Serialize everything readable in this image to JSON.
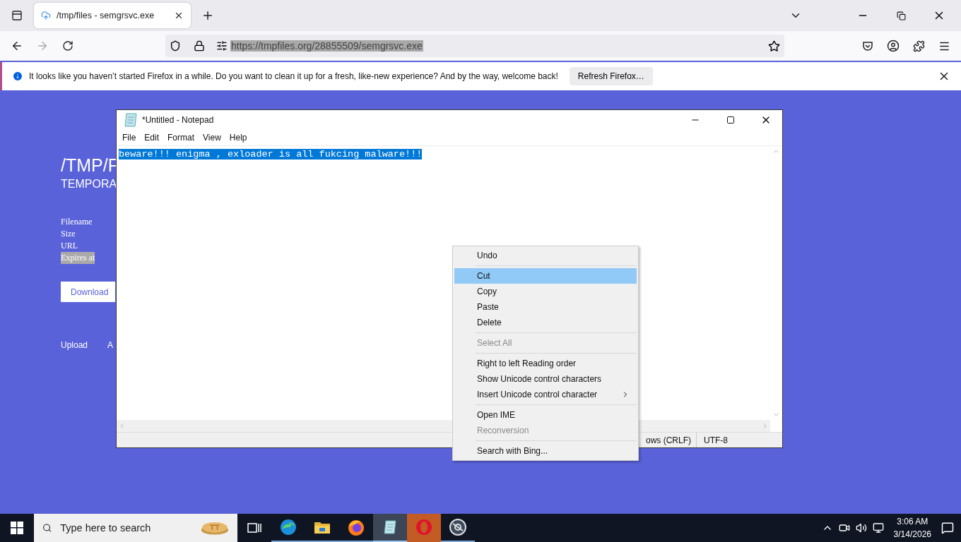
{
  "browser": {
    "tabs": [
      {
        "title": "/tmp/files - semgrsvc.exe",
        "selected": true
      }
    ],
    "url": "https://tmpfiles.org/28855509/semgrsvc.exe",
    "url_selected": true
  },
  "notification": {
    "message": "It looks like you haven’t started Firefox in a while. Do you want to clean it up for a fresh, like-new experience? And by the way, welcome back!",
    "button": "Refresh Firefox…"
  },
  "site": {
    "title": "/TMP/F",
    "subtitle": "TEMPORA",
    "fields": [
      {
        "label": "Filename",
        "highlighted": false
      },
      {
        "label": "Size",
        "highlighted": false
      },
      {
        "label": "URL",
        "highlighted": false
      },
      {
        "label": "Expires at",
        "highlighted": true
      }
    ],
    "download": "Download",
    "links": [
      "Upload",
      "A"
    ]
  },
  "notepad": {
    "title": "*Untitled - Notepad",
    "menu": [
      "File",
      "Edit",
      "Format",
      "View",
      "Help"
    ],
    "text": "beware!!! enigma , exloader is all fukcing malware!!!",
    "text_selected": true,
    "status": [
      "ows (CRLF)",
      "UTF-8"
    ]
  },
  "context_menu": [
    {
      "kind": "item",
      "label": "Undo",
      "disabled": false,
      "selected": false
    },
    {
      "kind": "separator"
    },
    {
      "kind": "item",
      "label": "Cut",
      "disabled": false,
      "selected": true
    },
    {
      "kind": "item",
      "label": "Copy",
      "disabled": false,
      "selected": false
    },
    {
      "kind": "item",
      "label": "Paste",
      "disabled": false,
      "selected": false
    },
    {
      "kind": "item",
      "label": "Delete",
      "disabled": false,
      "selected": false
    },
    {
      "kind": "separator"
    },
    {
      "kind": "item",
      "label": "Select All",
      "disabled": true,
      "selected": false
    },
    {
      "kind": "separator"
    },
    {
      "kind": "item",
      "label": "Right to left Reading order",
      "disabled": false,
      "selected": false
    },
    {
      "kind": "item",
      "label": "Show Unicode control characters",
      "disabled": false,
      "selected": false
    },
    {
      "kind": "submenu",
      "label": "Insert Unicode control character",
      "disabled": false,
      "selected": false
    },
    {
      "kind": "separator"
    },
    {
      "kind": "item",
      "label": "Open IME",
      "disabled": false,
      "selected": false
    },
    {
      "kind": "item",
      "label": "Reconversion",
      "disabled": true,
      "selected": false
    },
    {
      "kind": "separator"
    },
    {
      "kind": "item",
      "label": "Search with Bing...",
      "disabled": false,
      "selected": false
    }
  ],
  "taskbar": {
    "search_placeholder": "Type here to search",
    "apps": [
      {
        "kind": "edge",
        "selected": false,
        "attention": false
      },
      {
        "kind": "explorer",
        "selected": false,
        "attention": false
      },
      {
        "kind": "firefox",
        "selected": false,
        "attention": false
      },
      {
        "kind": "notepad",
        "selected": true,
        "attention": false
      },
      {
        "kind": "opera",
        "selected": false,
        "attention": true
      },
      {
        "kind": "app",
        "selected": false,
        "attention": false
      }
    ],
    "time": "3:06 AM",
    "date": "3/14/2026"
  }
}
